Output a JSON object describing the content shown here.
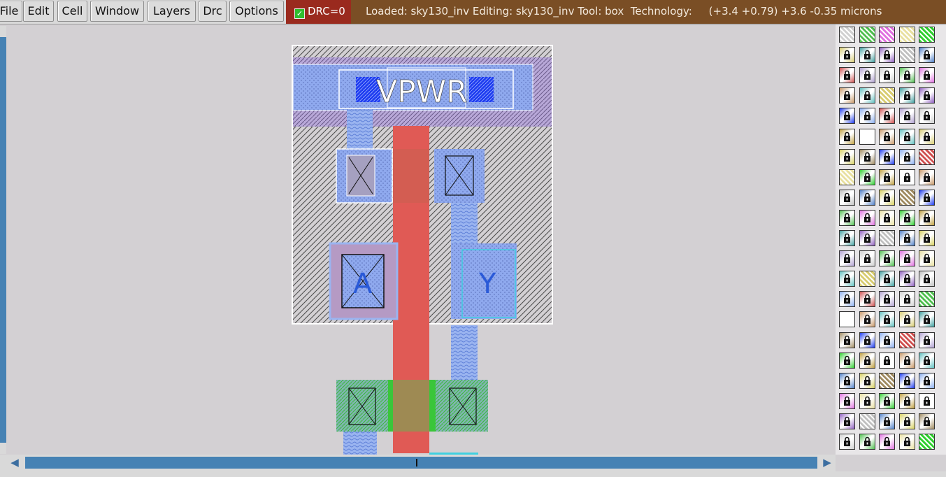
{
  "menu": {
    "items": [
      "File",
      "Edit",
      "Cell",
      "Window",
      "Layers",
      "Drc",
      "Options"
    ]
  },
  "drc": {
    "label": "DRC=0",
    "checked": true
  },
  "status": {
    "text": "Loaded: sky130_inv Editing: sky130_inv Tool: box  Technology:     (+3.4 +0.79) +3.6 -0.35 microns"
  },
  "layout": {
    "labels": {
      "power": "VPWR",
      "input": "A",
      "output": "Y"
    }
  },
  "palette": {
    "icon_name": "layer-swatch-icon",
    "locked_icon_name": "lock-icon"
  },
  "colors": {
    "menubar": "#d9d9d9",
    "drc_bg": "#9a2a1e",
    "status_bg": "#7a4e25",
    "scrollbar": "#4682b4",
    "canvas": "#d3d0d3",
    "poly": "#e05a55",
    "metal1": "#8faef0",
    "diff": "#3ac63a",
    "nwell_hatch": "#5a5a5a"
  }
}
